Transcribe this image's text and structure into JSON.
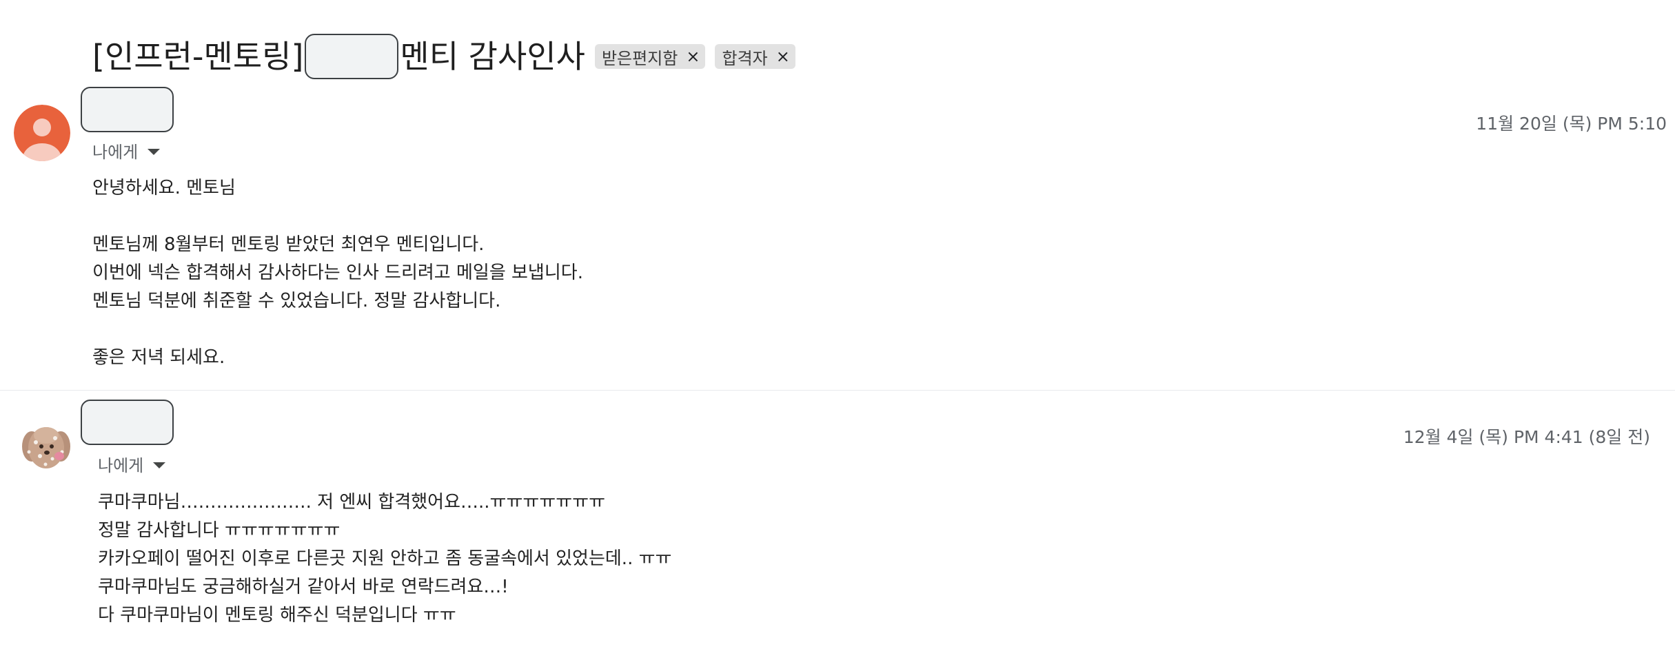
{
  "subject": {
    "prefix": "[인프런-멘토링]",
    "suffix": "멘티 감사인사",
    "labels": [
      {
        "name": "받은편지함",
        "remove_icon": "×"
      },
      {
        "name": "합격자",
        "remove_icon": "×"
      }
    ]
  },
  "messages": [
    {
      "recipient": "나에게",
      "date": "11월 20일 (목) PM 5:10",
      "avatar_color": "#e8623c",
      "body": [
        "안녕하세요. 멘토님",
        "",
        "멘토님께 8월부터 멘토링 받았던 최연우 멘티입니다.",
        "이번에 넥슨 합격해서 감사하다는 인사 드리려고 메일을 보냅니다.",
        "멘토님 덕분에 취준할 수 있었습니다. 정말 감사합니다.",
        "",
        "좋은 저녁 되세요."
      ]
    },
    {
      "recipient": "나에게",
      "date": "12월 4일 (목) PM 4:41 (8일 전)",
      "avatar_color": "#b08a73",
      "body": [
        "쿠마쿠마님…………………. 저 엔씨 합격했어요…..ㅠㅠㅠㅠㅠㅠㅠ",
        "정말 감사합니다 ㅠㅠㅠㅠㅠㅠㅠ",
        "카카오페이 떨어진 이후로 다른곳 지원 안하고 좀 동굴속에서 있었는데.. ㅠㅠ",
        "쿠마쿠마님도 궁금해하실거 같아서 바로 연락드려요…!",
        "다 쿠마쿠마님이 멘토링 해주신 덕분입니다 ㅠㅠ"
      ]
    }
  ]
}
